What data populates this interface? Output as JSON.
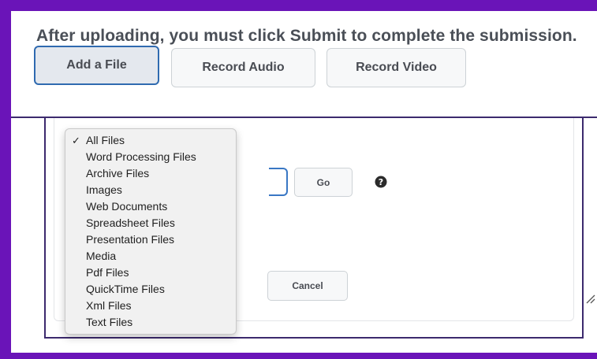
{
  "colors": {
    "frame": "#6a14b8",
    "focus_border": "#2f6ab0",
    "dark_outline": "#3c2a6e"
  },
  "instruction": "After uploading, you must click Submit to complete the submission.",
  "buttons": {
    "add_file": "Add a File",
    "record_audio": "Record Audio",
    "record_video": "Record Video"
  },
  "dialog": {
    "go_label": "Go",
    "cancel_label": "Cancel",
    "help_icon": "question-circle-icon",
    "resize_icon": "resize-handle-icon"
  },
  "file_type_dropdown": {
    "selected": "All Files",
    "options": [
      "All Files",
      "Word Processing Files",
      "Archive Files",
      "Images",
      "Web Documents",
      "Spreadsheet Files",
      "Presentation Files",
      "Media",
      "Pdf Files",
      "QuickTime Files",
      "Xml Files",
      "Text Files"
    ]
  }
}
